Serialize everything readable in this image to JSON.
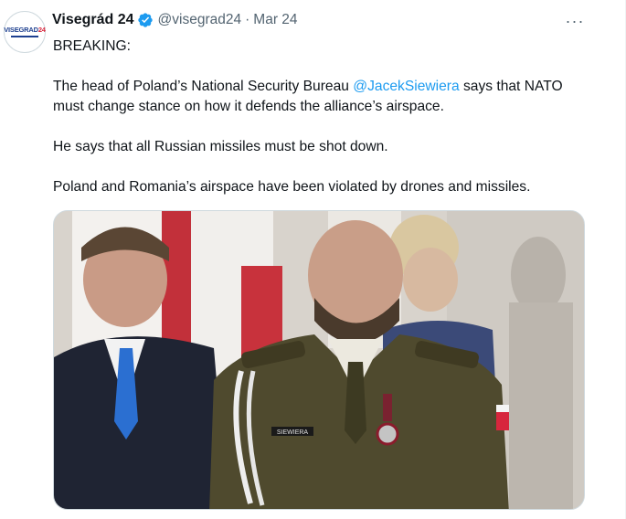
{
  "tweet": {
    "author": {
      "display_name": "Visegrád 24",
      "handle": "@visegrad24",
      "verified": true,
      "avatar_text_main": "VISEGRAD",
      "avatar_text_num": "24"
    },
    "separator": "·",
    "date": "Mar 24",
    "more_icon": "···",
    "text": {
      "line1": "BREAKING:",
      "p2_before": "The head of Poland’s National Security Bureau ",
      "p2_mention": "@JacekSiewiera",
      "p2_after": " says that NATO must change stance on how it defends the alliance’s airspace.",
      "p3": "He says that all Russian missiles must be shot down.",
      "p4": "Poland and Romania’s airspace have been violated by drones and missiles."
    },
    "media": {
      "name_tag": "SIEWIERA"
    }
  },
  "colors": {
    "link": "#1d9bf0",
    "verified": "#1d9bf0",
    "secondary_text": "#536471",
    "uniform": "#4f4a2e",
    "flag_red": "#d7263d"
  }
}
